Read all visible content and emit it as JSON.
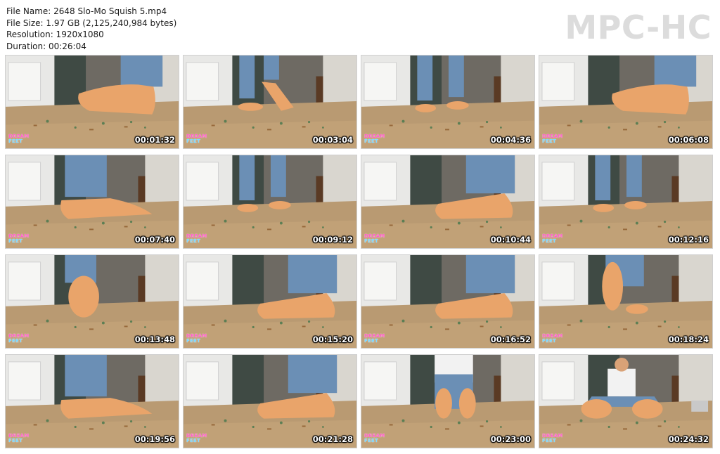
{
  "header": {
    "file_name": "File Name: 2648 Slo-Mo Squish 5.mp4",
    "file_size": "File Size: 1.97 GB (2,125,240,984 bytes)",
    "resolution": "Resolution: 1920x1080",
    "duration": "Duration: 00:26:04"
  },
  "logo": "MPC-HC",
  "watermark": {
    "line1": "DREAM",
    "line2": "FEET"
  },
  "colors": {
    "logo": "#dcdcdc",
    "floor": "#b99a72",
    "wall": "#6e6a63",
    "skin": "#e9a46a",
    "jeans": "#6b8fb5"
  },
  "thumbnails": [
    {
      "time": "00:01:32",
      "scene": "foot-side-right"
    },
    {
      "time": "00:03:04",
      "scene": "standing-raised"
    },
    {
      "time": "00:04:36",
      "scene": "standing-far"
    },
    {
      "time": "00:06:08",
      "scene": "foot-side-right"
    },
    {
      "time": "00:07:40",
      "scene": "foot-side-left"
    },
    {
      "time": "00:09:12",
      "scene": "standing-far"
    },
    {
      "time": "00:10:44",
      "scene": "foot-side-center"
    },
    {
      "time": "00:12:16",
      "scene": "standing-far"
    },
    {
      "time": "00:13:48",
      "scene": "sole-raised-left"
    },
    {
      "time": "00:15:20",
      "scene": "foot-side-center"
    },
    {
      "time": "00:16:52",
      "scene": "foot-side-center"
    },
    {
      "time": "00:18:24",
      "scene": "sole-raised-center"
    },
    {
      "time": "00:19:56",
      "scene": "foot-side-left"
    },
    {
      "time": "00:21:28",
      "scene": "foot-side-center"
    },
    {
      "time": "00:23:00",
      "scene": "kneeling-soles"
    },
    {
      "time": "00:24:32",
      "scene": "sitting-soles"
    }
  ]
}
